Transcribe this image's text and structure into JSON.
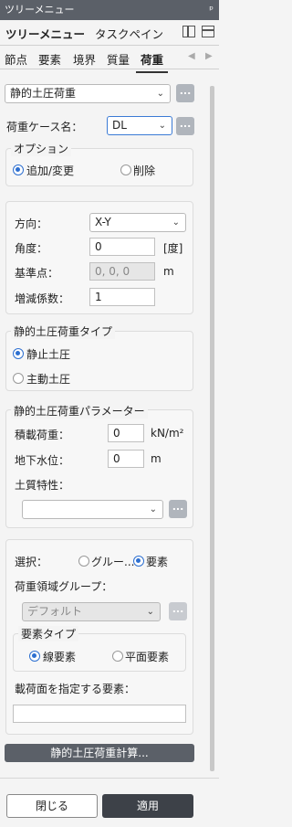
{
  "window": {
    "title": "ツリーメニュー",
    "pin": "ᵖ"
  },
  "top_tabs": [
    "ツリーメニュー",
    "タスクペイン"
  ],
  "sub_tabs": [
    "節点",
    "要素",
    "境界",
    "質量",
    "荷重"
  ],
  "load_type": {
    "value": "静的土圧荷重",
    "more": "..."
  },
  "load_case": {
    "label": "荷重ケース名：",
    "value": "DL",
    "more": "..."
  },
  "options": {
    "legend": "オプション",
    "add": "追加/変更",
    "delete": "削除",
    "selected": "add"
  },
  "direction": {
    "label": "方向：",
    "value": "X-Y"
  },
  "angle": {
    "label": "角度：",
    "value": "0",
    "unit": "[度]"
  },
  "base_point": {
    "label": "基準点：",
    "value": "0, 0, 0",
    "unit": "m"
  },
  "factor": {
    "label": "増減係数：",
    "value": "1"
  },
  "pressure_type": {
    "legend": "静的土圧荷重タイプ",
    "at_rest": "静止土圧",
    "active": "主動土圧",
    "selected": "at_rest"
  },
  "params": {
    "legend": "静的土圧荷重パラメーター",
    "surcharge_label": "積載荷重：",
    "surcharge_value": "0",
    "surcharge_unit": "kN/m²",
    "water_label": "地下水位：",
    "water_value": "0",
    "water_unit": "m",
    "soil_label": "土質特性：",
    "soil_value": "",
    "more": "..."
  },
  "selection": {
    "label": "選択：",
    "group": "グルー...",
    "element": "要素",
    "selected": "element",
    "region_label": "荷重領域グループ：",
    "region_value": "デフォルト",
    "more": "...",
    "elem_type_legend": "要素タイプ",
    "line": "線要素",
    "plane": "平面要素",
    "elem_type_selected": "line",
    "load_surface_label": "載荷面を指定する要素：",
    "load_surface_value": ""
  },
  "calc_button": "静的土圧荷重計算...",
  "close_button": "閉じる",
  "apply_button": "適用"
}
